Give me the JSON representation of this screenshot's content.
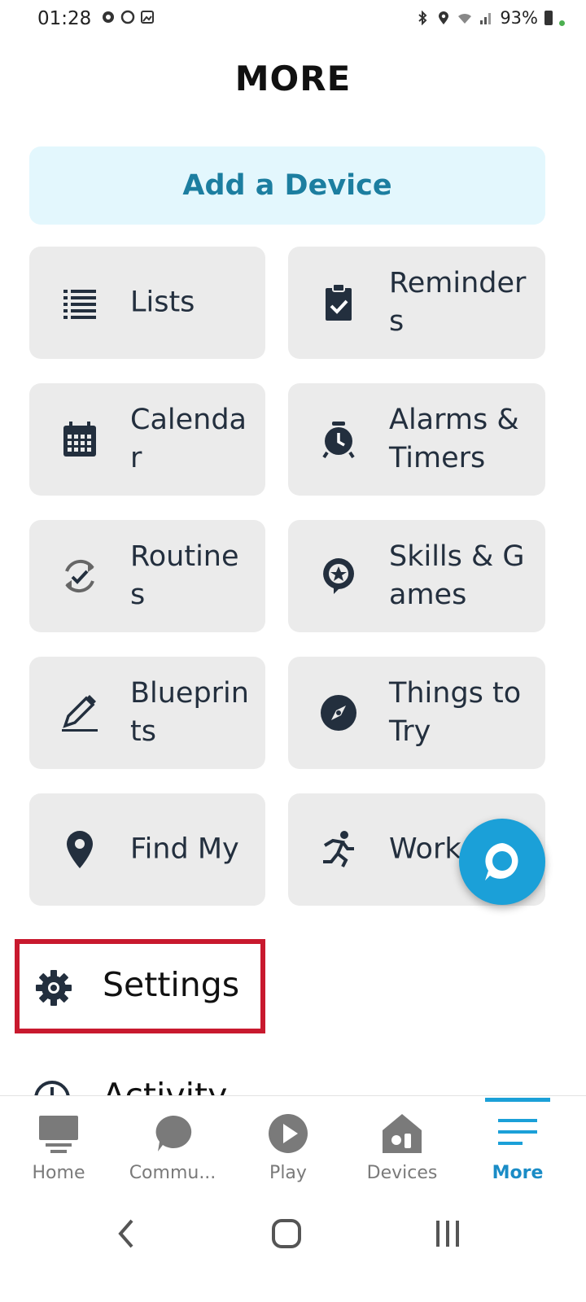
{
  "status_bar": {
    "time": "01:28",
    "battery": "93%",
    "icons": [
      "bluetooth-icon",
      "location-icon",
      "wifi-icon",
      "signal-icon",
      "battery-icon"
    ]
  },
  "header": {
    "title": "MORE"
  },
  "add_device": {
    "label": "Add a Device"
  },
  "tiles": [
    {
      "label": "Lists",
      "icon": "list-icon"
    },
    {
      "label": "Reminders",
      "icon": "clipboard-check-icon"
    },
    {
      "label": "Calendar",
      "icon": "calendar-icon"
    },
    {
      "label": "Alarms & Timers",
      "icon": "alarm-clock-icon"
    },
    {
      "label": "Routines",
      "icon": "routines-icon"
    },
    {
      "label": "Skills & Games",
      "icon": "skills-icon"
    },
    {
      "label": "Blueprints",
      "icon": "pencil-icon"
    },
    {
      "label": "Things to Try",
      "icon": "compass-icon"
    },
    {
      "label": "Find My",
      "icon": "location-pin-icon"
    },
    {
      "label": "Workouts",
      "icon": "running-icon"
    }
  ],
  "settings": {
    "label": "Settings"
  },
  "activity": {
    "label": "Activity"
  },
  "tabs": [
    {
      "label": "Home",
      "icon": "home-icon"
    },
    {
      "label": "Commu...",
      "icon": "chat-bubble-icon"
    },
    {
      "label": "Play",
      "icon": "play-icon"
    },
    {
      "label": "Devices",
      "icon": "devices-icon"
    },
    {
      "label": "More",
      "icon": "menu-icon",
      "active": true
    }
  ],
  "colors": {
    "accent": "#1ba0d8",
    "add_device_bg": "#e3f7fd",
    "add_device_text": "#1c7ea0",
    "tile_bg": "#ebebeb",
    "highlight_border": "#c8192e"
  }
}
